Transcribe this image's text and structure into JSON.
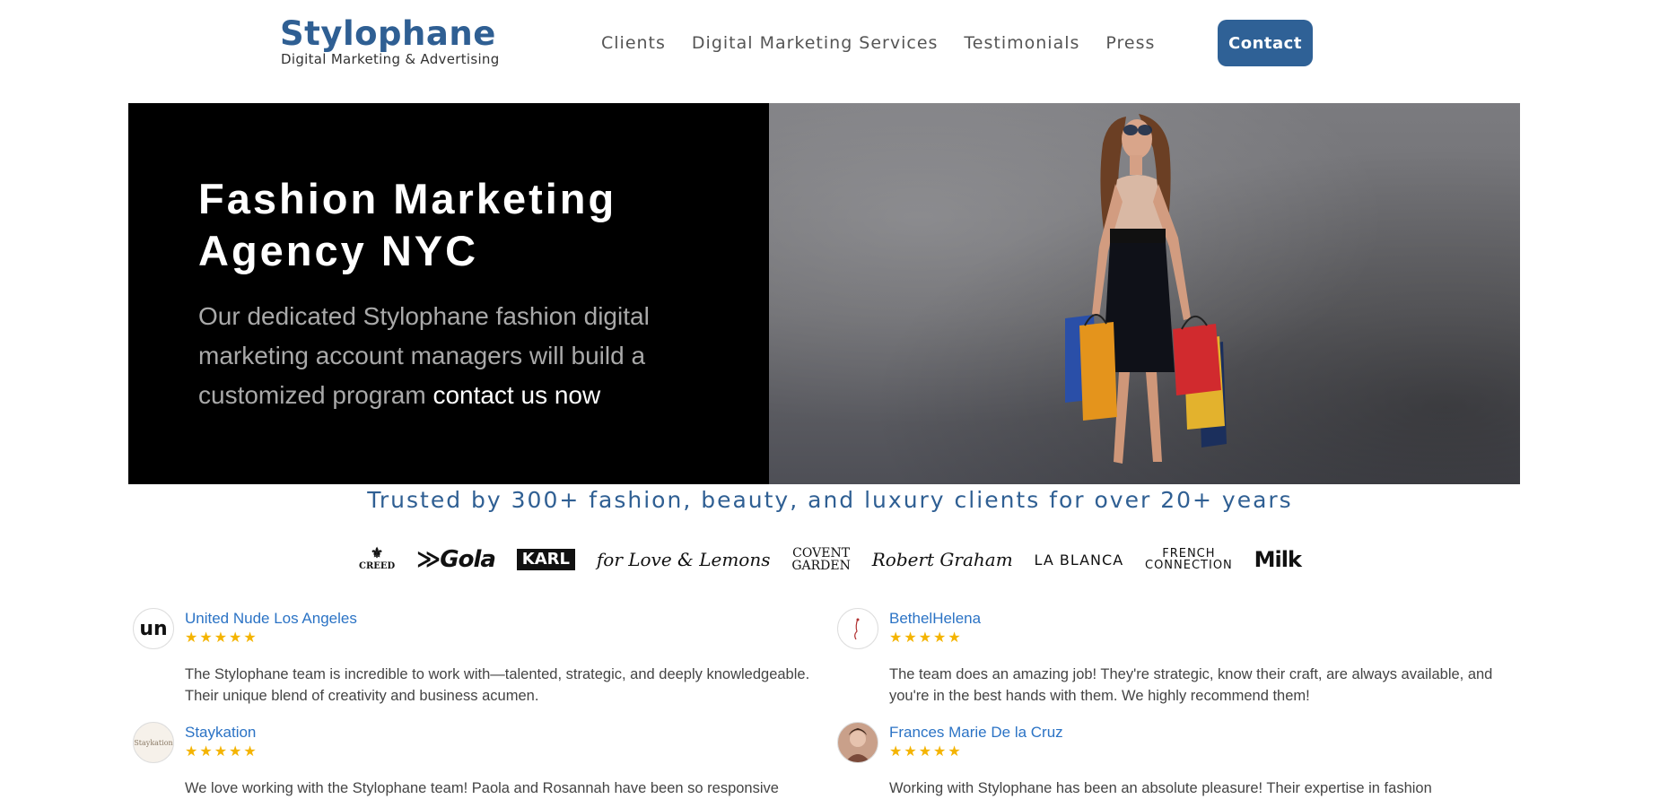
{
  "header": {
    "logo_main": "Stylophane",
    "logo_sub": "Digital Marketing & Advertising",
    "nav": [
      "Clients",
      "Digital Marketing Services",
      "Testimonials",
      "Press"
    ],
    "contact_label": "Contact"
  },
  "hero": {
    "title": "Fashion Marketing Agency NYC",
    "text": "Our dedicated Stylophane fashion digital marketing account managers will build a customized program ",
    "link": "contact us now"
  },
  "trusted": "Trusted by 300+ fashion, beauty, and luxury clients for over 20+ years",
  "brands": {
    "creed": "CREED",
    "gola": "Gola",
    "karl": "KARL",
    "love_lemons": "for Love & Lemons",
    "covent_1": "COVENT",
    "covent_2": "GARDEN",
    "robert_graham": "Robert Graham",
    "la_blanca": "LA BLANCA",
    "french_1": "FRENCH",
    "french_2": "CONNECTION",
    "milk": "Milk"
  },
  "reviews": [
    {
      "name": "United Nude Los Angeles",
      "avatar": "un",
      "stars": "★★★★★",
      "text": "The Stylophane team is incredible to work with—talented, strategic, and deeply knowledgeable. Their unique blend of creativity and business acumen."
    },
    {
      "name": "BethelHelena",
      "avatar": "",
      "stars": "★★★★★",
      "text": "The team does an amazing job! They're strategic, know their craft, are always available, and you're in the best hands with them. We highly recommend them!"
    },
    {
      "name": "Staykation",
      "avatar": "Staykation",
      "stars": "★★★★★",
      "text": "We love working with the Stylophane team! Paola and Rosannah have been so responsive"
    },
    {
      "name": "Frances Marie De la Cruz",
      "avatar": "",
      "stars": "★★★★★",
      "text": "Working with Stylophane has been an absolute pleasure! Their expertise in fashion"
    }
  ],
  "colors": {
    "brand_blue": "#2f5f93",
    "button_blue": "#2f6196",
    "link_blue": "#2b73c5",
    "star_gold": "#f4b400"
  }
}
